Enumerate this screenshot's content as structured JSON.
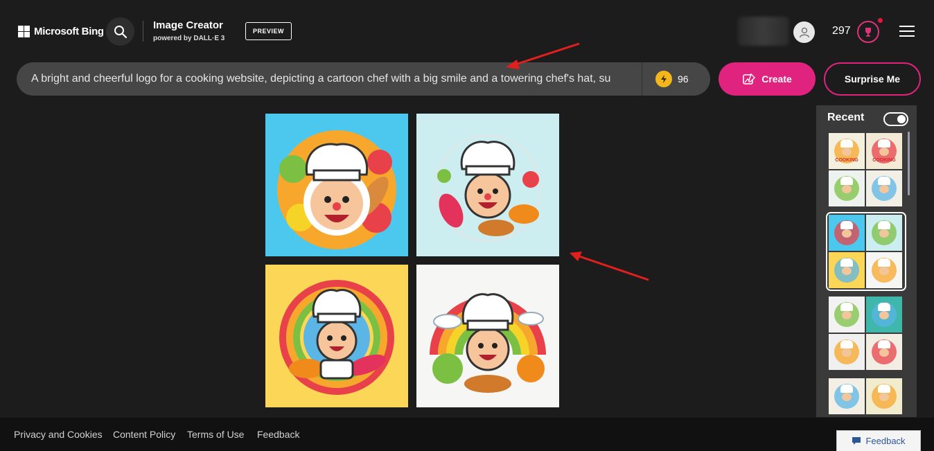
{
  "brand": {
    "name": "Microsoft Bing"
  },
  "product": {
    "title": "Image Creator",
    "subtitle": "powered by DALL·E 3",
    "badge": "PREVIEW"
  },
  "user": {
    "points": "297"
  },
  "prompt": {
    "text": "A bright and cheerful logo for a cooking website, depicting a cartoon chef with a big smile and a towering chef's hat, su",
    "boosts": "96"
  },
  "actions": {
    "create": "Create",
    "surprise": "Surprise Me"
  },
  "recent": {
    "title": "Recent",
    "groups": [
      {
        "cells": [
          {
            "bg": "#f4f0e0",
            "label": "COOKING"
          },
          {
            "bg": "#f3ead6",
            "label": "COOKING"
          },
          {
            "bg": "#eef2ee",
            "label": ""
          },
          {
            "bg": "#f2efe6",
            "label": ""
          }
        ]
      },
      {
        "cells": [
          {
            "bg": "#4cc8ef",
            "label": ""
          },
          {
            "bg": "#cdeef1",
            "label": ""
          },
          {
            "bg": "#fbd657",
            "label": ""
          },
          {
            "bg": "#f6f6f4",
            "label": ""
          }
        ]
      },
      {
        "cells": [
          {
            "bg": "#f2f2f2",
            "label": ""
          },
          {
            "bg": "#3fb7ab",
            "label": ""
          },
          {
            "bg": "#f0f0f0",
            "label": ""
          },
          {
            "bg": "#f3eee4",
            "label": ""
          }
        ]
      },
      {
        "cells": [
          {
            "bg": "#f3efe4",
            "label": ""
          },
          {
            "bg": "#f2eccf",
            "label": ""
          }
        ]
      }
    ]
  },
  "footer": {
    "links": [
      "Privacy and Cookies",
      "Content Policy",
      "Terms of Use",
      "Feedback"
    ],
    "feedback_button": "Feedback"
  },
  "colors": {
    "accent": "#e0237f",
    "background": "#1c1c1c",
    "annotation_arrow": "#e01f1f"
  }
}
